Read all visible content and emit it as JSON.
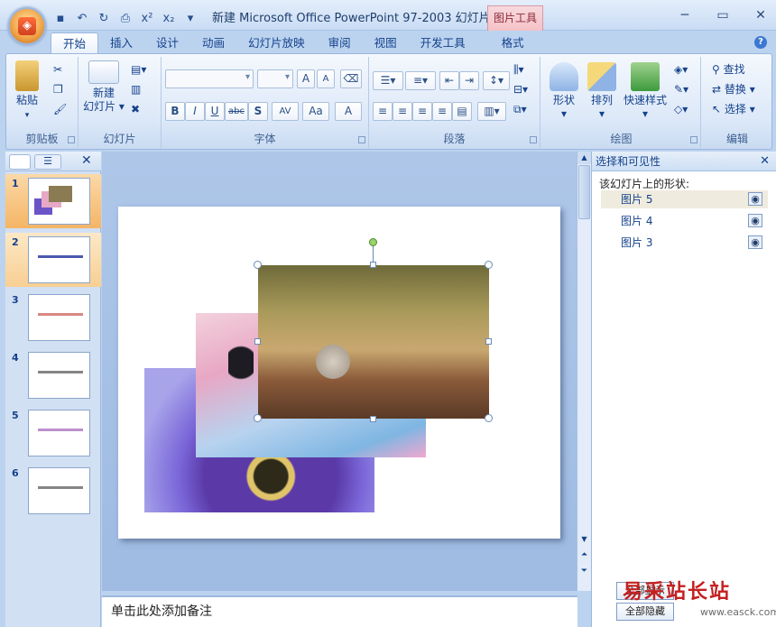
{
  "title": "新建 Microsoft Office PowerPoint 97-2003 幻灯片...",
  "context_tab": "图片工具",
  "tabs": [
    "开始",
    "插入",
    "设计",
    "动画",
    "幻灯片放映",
    "审阅",
    "视图",
    "开发工具",
    "格式"
  ],
  "ribbon": {
    "clipboard": {
      "label": "剪贴板",
      "paste": "粘贴"
    },
    "slides": {
      "label": "幻灯片",
      "new_slide_line1": "新建",
      "new_slide_line2": "幻灯片"
    },
    "font": {
      "label": "字体",
      "bold": "B",
      "italic": "I",
      "underline": "U",
      "strike": "abc",
      "shadow": "S",
      "spacing": "AV",
      "case": "Aa",
      "grow": "A",
      "shrink": "A",
      "color": "A"
    },
    "paragraph": {
      "label": "段落"
    },
    "drawing": {
      "label": "绘图",
      "shapes": "形状",
      "arrange": "排列",
      "quick_styles": "快速样式"
    },
    "editing": {
      "label": "编辑",
      "find": "查找",
      "replace": "替换",
      "select": "选择"
    }
  },
  "slides": [
    {
      "num": "1"
    },
    {
      "num": "2"
    },
    {
      "num": "3"
    },
    {
      "num": "4"
    },
    {
      "num": "5"
    },
    {
      "num": "6"
    }
  ],
  "selection_pane": {
    "title": "选择和可见性",
    "subtitle": "该幻灯片上的形状:",
    "shapes": [
      "图片 5",
      "图片 4",
      "图片 3"
    ],
    "show_all": "全部显示",
    "hide_all": "全部隐藏"
  },
  "notes_placeholder": "单击此处添加备注",
  "watermark": "易采站长站",
  "watermark_url": "www.easck.com"
}
